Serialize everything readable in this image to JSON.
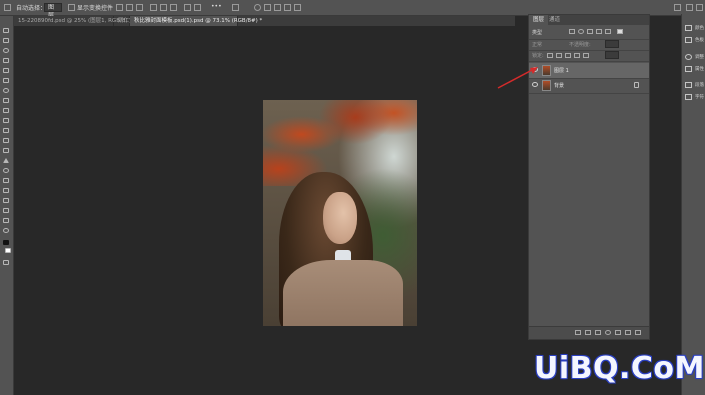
{
  "options_bar": {
    "auto_select_label": "自动选择：",
    "auto_select_value": "图层",
    "show_transform_label": "显示变换控件",
    "more_label": "•••"
  },
  "tabs": [
    {
      "label": "15-220890fd.psd @ 25% (图层1, RGB/8) *"
    },
    {
      "label": "同仁堂封面模板.psd @ 16.7% (RGB/8#)"
    },
    {
      "label": "秋比雅封面模板.psd(1).psd @ 73.1% (RGB/8#) *"
    }
  ],
  "panel": {
    "tabs": [
      {
        "label": "图层"
      },
      {
        "label": "通道"
      }
    ],
    "kind_label": "类型",
    "mode_label": "正常",
    "opacity_label": "不透明度:",
    "lock_label": "锁定:",
    "layers": [
      {
        "name": "图层 1"
      },
      {
        "name": "背景"
      }
    ]
  },
  "right_strip": {
    "items": [
      {
        "label": "颜色"
      },
      {
        "label": "色板"
      },
      {
        "label": "调整"
      },
      {
        "label": "属性"
      },
      {
        "label": "段落"
      },
      {
        "label": "字符"
      }
    ]
  },
  "annotation": {
    "color": "#d42b2b"
  },
  "watermark": {
    "text": "UiBQ.CoM",
    "color": "#2a3fc2"
  }
}
